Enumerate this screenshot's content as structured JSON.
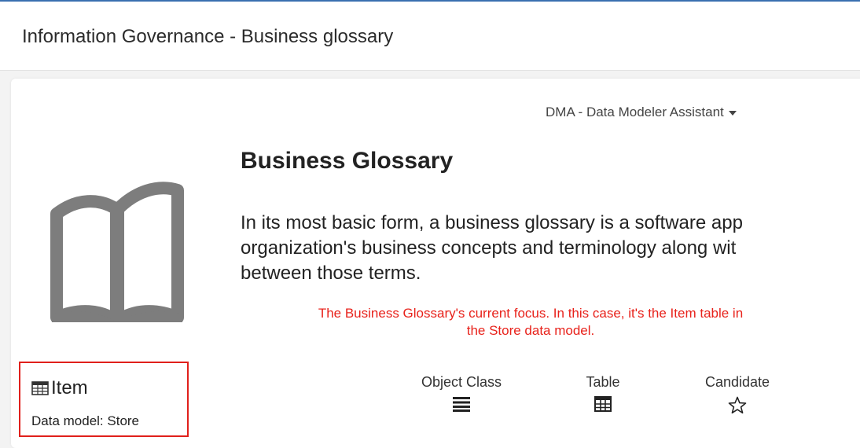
{
  "header": {
    "title": "Information Governance - Business glossary"
  },
  "menu": {
    "label": "DMA - Data Modeler Assistant"
  },
  "main": {
    "icon": "open-book-icon",
    "title": "Business Glossary",
    "description_lines": [
      "In its most basic form, a business glossary is a software app",
      "organization's business concepts and terminology along wit",
      "between those terms."
    ]
  },
  "annotation": {
    "lines": [
      "The Business Glossary's current focus. In this case, it's the Item table in",
      "the Store data model."
    ],
    "color": "#e8221b"
  },
  "focus": {
    "icon": "table-icon",
    "name": "Item",
    "model": "Data model: Store",
    "border_color": "#e0201b"
  },
  "properties": [
    {
      "label": "Object Class",
      "icon": "list-lines-icon"
    },
    {
      "label": "Table",
      "icon": "table-grid-icon"
    },
    {
      "label": "Candidate",
      "icon": "star-outline-icon"
    }
  ]
}
